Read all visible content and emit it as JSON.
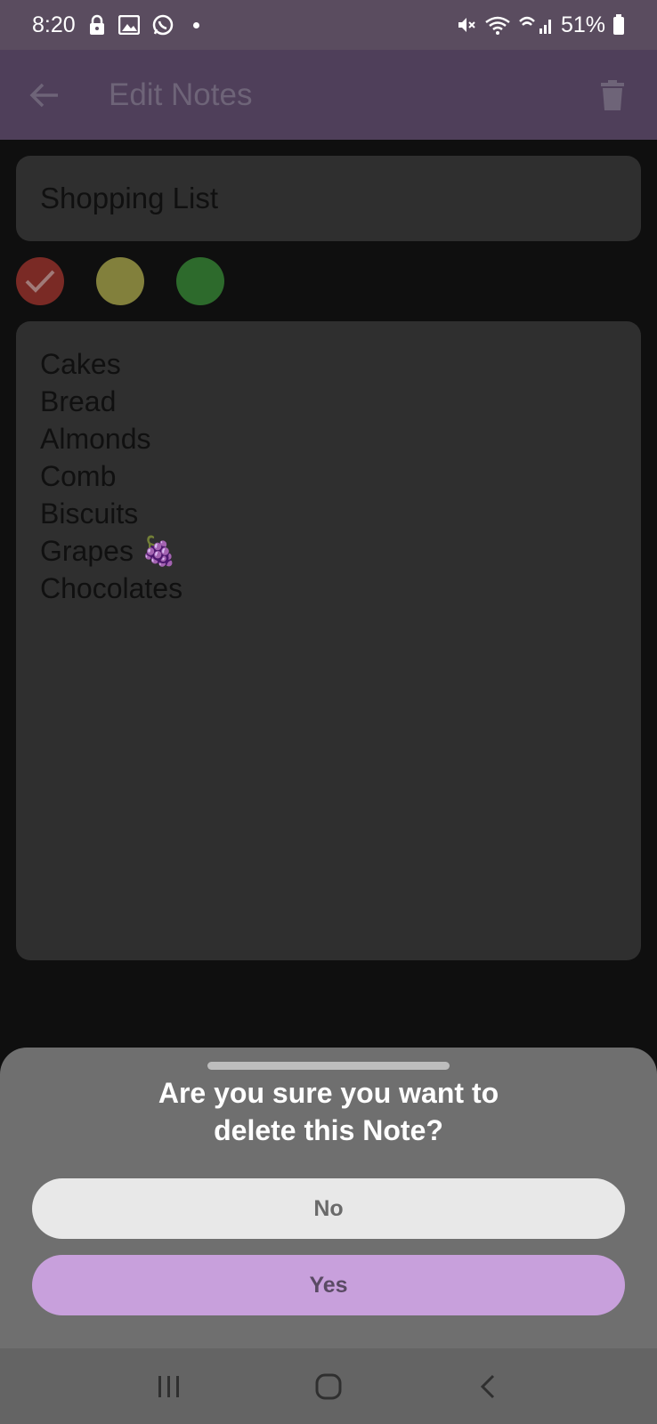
{
  "status_bar": {
    "time": "8:20",
    "battery": "51%",
    "icons_left": [
      "lock-icon",
      "image-icon",
      "whatsapp-icon"
    ],
    "icons_right": [
      "mute-icon",
      "wifi-icon",
      "call-signal-icon",
      "battery-icon"
    ]
  },
  "app_bar": {
    "title": "Edit Notes",
    "back_icon": "arrow-left-icon",
    "delete_icon": "trash-icon",
    "background": "#4f3f5a"
  },
  "note": {
    "title": "Shopping List",
    "colors": [
      {
        "name": "red",
        "hex": "#7a2a25",
        "selected": true
      },
      {
        "name": "yellow",
        "hex": "#82803c",
        "selected": false
      },
      {
        "name": "green",
        "hex": "#2d6a2c",
        "selected": false
      }
    ],
    "body_lines": [
      "Cakes",
      "Bread",
      "Almonds",
      "Comb",
      "Biscuits",
      "Grapes 🍇",
      "Chocolates"
    ]
  },
  "dialog": {
    "message": "Are you sure you want to delete this Note?",
    "no_label": "No",
    "yes_label": "Yes",
    "yes_color": "#c8a0dc"
  },
  "nav_bar": {
    "buttons": [
      "recents-icon",
      "home-icon",
      "back-icon"
    ]
  }
}
